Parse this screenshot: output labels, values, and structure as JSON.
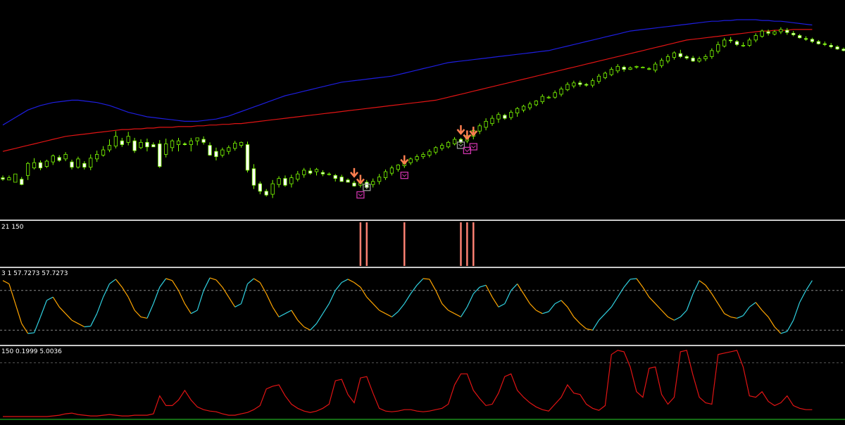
{
  "chart_data": [
    {
      "type": "candlestick",
      "pane": "price",
      "colors": {
        "background": "#000000",
        "bull": "#7CFC00",
        "bear": "#FFFFFF",
        "upper_band": "#1E1EE0",
        "lower_band": "#E01414",
        "arrow": "#FF7F50",
        "marker_magenta": "#CC33AA",
        "marker_gray": "#9A9A9A"
      },
      "candles": [
        [
          215,
          213,
          218,
          211
        ],
        [
          212,
          215,
          214,
          218
        ],
        [
          209,
          220,
          214,
          210
        ],
        [
          213,
          206,
          216,
          205
        ],
        [
          218,
          234,
          212,
          236
        ],
        [
          228,
          235,
          226,
          241
        ],
        [
          235,
          228,
          238,
          225
        ],
        [
          230,
          237,
          228,
          239
        ],
        [
          236,
          244,
          232,
          246
        ],
        [
          242,
          238,
          245,
          236
        ],
        [
          240,
          246,
          237,
          249
        ],
        [
          236,
          229,
          239,
          226
        ],
        [
          229,
          240,
          227,
          243
        ],
        [
          234,
          229,
          237,
          226
        ],
        [
          229,
          241,
          225,
          246
        ],
        [
          240,
          246,
          236,
          251
        ],
        [
          245,
          252,
          243,
          257
        ],
        [
          252,
          258,
          249,
          266
        ],
        [
          257,
          270,
          254,
          277
        ],
        [
          264,
          259,
          268,
          256
        ],
        [
          262,
          270,
          258,
          276
        ],
        [
          264,
          251,
          268,
          248
        ],
        [
          255,
          262,
          253,
          266
        ],
        [
          262,
          256,
          267,
          250
        ],
        [
          259,
          256,
          262,
          256
        ],
        [
          260,
          230,
          265,
          228
        ],
        [
          246,
          260,
          242,
          267
        ],
        [
          255,
          264,
          250,
          266
        ],
        [
          259,
          264,
          250,
          268
        ],
        [
          260,
          259,
          262,
          258
        ],
        [
          259,
          264,
          250,
          268
        ],
        [
          264,
          268,
          258,
          268
        ],
        [
          266,
          262,
          270,
          259
        ],
        [
          258,
          245,
          262,
          244
        ],
        [
          250,
          243,
          255,
          238
        ],
        [
          245,
          252,
          242,
          255
        ],
        [
          250,
          255,
          246,
          258
        ],
        [
          254,
          261,
          251,
          264
        ],
        [
          258,
          262,
          255,
          263
        ],
        [
          259,
          225,
          263,
          222
        ],
        [
          227,
          205,
          233,
          200
        ],
        [
          207,
          197,
          210,
          193
        ],
        [
          197,
          192,
          200,
          190
        ],
        [
          193,
          207,
          188,
          212
        ],
        [
          206,
          214,
          202,
          217
        ],
        [
          214,
          205,
          218,
          203
        ],
        [
          207,
          215,
          202,
          219
        ],
        [
          213,
          220,
          210,
          224
        ],
        [
          219,
          225,
          215,
          228
        ],
        [
          224,
          221,
          228,
          219
        ],
        [
          223,
          226,
          218,
          228
        ],
        [
          222,
          220,
          225,
          217
        ],
        [
          220,
          220,
          222,
          218
        ],
        [
          218,
          214,
          220,
          210
        ],
        [
          216,
          210,
          219,
          210
        ],
        [
          212,
          209,
          214,
          210
        ],
        [
          208,
          204,
          211,
          203
        ],
        [
          205,
          210,
          202,
          212
        ],
        [
          209,
          202,
          212,
          200
        ],
        [
          206,
          210,
          202,
          214
        ],
        [
          210,
          216,
          206,
          220
        ],
        [
          215,
          223,
          212,
          226
        ],
        [
          221,
          228,
          218,
          231
        ],
        [
          226,
          232,
          223,
          233
        ],
        [
          231,
          236,
          228,
          238
        ],
        [
          235,
          240,
          232,
          242
        ],
        [
          239,
          243,
          236,
          246
        ],
        [
          243,
          246,
          240,
          249
        ],
        [
          245,
          250,
          242,
          253
        ],
        [
          249,
          255,
          246,
          257
        ],
        [
          254,
          258,
          251,
          261
        ],
        [
          256,
          262,
          254,
          264
        ],
        [
          260,
          266,
          258,
          269
        ],
        [
          266,
          262,
          268,
          260
        ],
        [
          264,
          271,
          261,
          274
        ],
        [
          270,
          278,
          266,
          282
        ],
        [
          277,
          284,
          273,
          287
        ],
        [
          282,
          290,
          278,
          294
        ],
        [
          287,
          294,
          284,
          298
        ],
        [
          293,
          299,
          288,
          302
        ],
        [
          298,
          294,
          300,
          292
        ],
        [
          295,
          302,
          292,
          305
        ],
        [
          301,
          307,
          296,
          309
        ],
        [
          305,
          310,
          302,
          312
        ],
        [
          308,
          313,
          305,
          316
        ],
        [
          312,
          317,
          310,
          318
        ],
        [
          316,
          323,
          313,
          326
        ],
        [
          322,
          322,
          324,
          320
        ],
        [
          322,
          328,
          320,
          331
        ],
        [
          326,
          333,
          323,
          336
        ],
        [
          332,
          339,
          330,
          342
        ],
        [
          337,
          341,
          334,
          344
        ],
        [
          341,
          339,
          344,
          336
        ],
        [
          339,
          338,
          341,
          336
        ],
        [
          338,
          344,
          335,
          347
        ],
        [
          343,
          350,
          340,
          353
        ],
        [
          348,
          354,
          346,
          356
        ],
        [
          352,
          359,
          350,
          362
        ],
        [
          357,
          363,
          354,
          366
        ],
        [
          362,
          359,
          364,
          356
        ],
        [
          359,
          361,
          358,
          363
        ],
        [
          362,
          363,
          360,
          364
        ],
        [
          362,
          362,
          363,
          361
        ],
        [
          360,
          360,
          362,
          358
        ],
        [
          358,
          366,
          355,
          369
        ],
        [
          364,
          371,
          361,
          374
        ],
        [
          370,
          376,
          367,
          379
        ],
        [
          375,
          381,
          372,
          383
        ],
        [
          380,
          376,
          385,
          374
        ],
        [
          376,
          374,
          378,
          372
        ],
        [
          374,
          370,
          377,
          369
        ],
        [
          370,
          373,
          368,
          376
        ],
        [
          373,
          376,
          370,
          379
        ],
        [
          376,
          384,
          373,
          387
        ],
        [
          383,
          392,
          380,
          396
        ],
        [
          390,
          398,
          388,
          401
        ],
        [
          398,
          397,
          402,
          394
        ],
        [
          396,
          392,
          398,
          390
        ],
        [
          391,
          391,
          395,
          389
        ],
        [
          391,
          398,
          389,
          401
        ],
        [
          398,
          404,
          395,
          407
        ],
        [
          403,
          410,
          401,
          412
        ],
        [
          409,
          407,
          412,
          404
        ],
        [
          406,
          409,
          404,
          411
        ],
        [
          409,
          412,
          406,
          415
        ],
        [
          411,
          408,
          414,
          405
        ],
        [
          407,
          405,
          410,
          403
        ],
        [
          404,
          401,
          406,
          400
        ],
        [
          400,
          399,
          403,
          397
        ],
        [
          399,
          396,
          401,
          394
        ],
        [
          396,
          393,
          398,
          392
        ],
        [
          393,
          392,
          396,
          390
        ],
        [
          391,
          389,
          394,
          387
        ],
        [
          389,
          386,
          391,
          385
        ],
        [
          386,
          384,
          388,
          383
        ]
      ],
      "upper_band": [
        285,
        290,
        295,
        300,
        305,
        308,
        311,
        313,
        315,
        316,
        317,
        318,
        318,
        317,
        316,
        315,
        313,
        311,
        308,
        305,
        302,
        300,
        298,
        296,
        295,
        294,
        293,
        292,
        291,
        290,
        290,
        290,
        291,
        292,
        293,
        295,
        297,
        300,
        303,
        306,
        309,
        312,
        315,
        318,
        321,
        324,
        326,
        328,
        330,
        332,
        334,
        336,
        338,
        340,
        342,
        343,
        344,
        345,
        346,
        347,
        348,
        349,
        350,
        352,
        354,
        356,
        358,
        360,
        362,
        364,
        366,
        368,
        369,
        370,
        371,
        372,
        373,
        374,
        375,
        376,
        377,
        378,
        379,
        380,
        381,
        382,
        383,
        384,
        386,
        388,
        390,
        392,
        394,
        396,
        398,
        400,
        402,
        404,
        406,
        408,
        410,
        411,
        412,
        413,
        414,
        415,
        416,
        417,
        418,
        419,
        420,
        421,
        422,
        423,
        423,
        424,
        424,
        425,
        425,
        425,
        425,
        424,
        424,
        423,
        423,
        422,
        421,
        420,
        419,
        418
      ],
      "lower_band": [
        250,
        252,
        254,
        256,
        258,
        260,
        262,
        264,
        266,
        268,
        270,
        271,
        272,
        273,
        274,
        275,
        276,
        277,
        278,
        279,
        279,
        280,
        280,
        281,
        281,
        282,
        282,
        282,
        283,
        283,
        283,
        284,
        284,
        285,
        285,
        286,
        286,
        287,
        287,
        288,
        289,
        290,
        291,
        292,
        293,
        294,
        295,
        296,
        297,
        298,
        299,
        300,
        301,
        302,
        303,
        304,
        305,
        306,
        307,
        308,
        309,
        310,
        311,
        312,
        313,
        314,
        315,
        316,
        317,
        318,
        320,
        322,
        324,
        326,
        328,
        330,
        332,
        334,
        336,
        338,
        340,
        342,
        344,
        346,
        348,
        350,
        352,
        354,
        356,
        358,
        360,
        362,
        364,
        366,
        368,
        370,
        372,
        374,
        376,
        378,
        380,
        382,
        384,
        386,
        388,
        390,
        392,
        394,
        396,
        398,
        399,
        400,
        401,
        402,
        403,
        404,
        405,
        406,
        407,
        408,
        409,
        410,
        410,
        411,
        411,
        411,
        412,
        412,
        412,
        412
      ],
      "arrows": [
        56,
        57,
        64,
        73,
        74,
        75
      ],
      "markers": [
        {
          "bar": 57,
          "style": "magenta"
        },
        {
          "bar": 58,
          "style": "gray"
        },
        {
          "bar": 64,
          "style": "magenta"
        },
        {
          "bar": 73,
          "style": "gray"
        },
        {
          "bar": 74,
          "style": "magenta"
        },
        {
          "bar": 75,
          "style": "magenta"
        }
      ]
    },
    {
      "type": "signal",
      "pane": "signals",
      "label": "21 150",
      "color": "#FA8072",
      "signal_bars": [
        57,
        58,
        64,
        73,
        74,
        75
      ]
    },
    {
      "type": "line",
      "pane": "oscillator",
      "label": "3 1 57.7273 57.7273",
      "colors": {
        "up": "#30D0E0",
        "down": "#FFA500",
        "level": "#888888"
      },
      "levels": [
        80,
        20
      ],
      "ylim": [
        0,
        100
      ],
      "values": [
        95,
        90,
        60,
        30,
        15,
        16,
        40,
        65,
        70,
        55,
        45,
        35,
        30,
        25,
        26,
        45,
        70,
        90,
        97,
        85,
        70,
        50,
        40,
        38,
        60,
        85,
        98,
        95,
        80,
        60,
        45,
        50,
        80,
        99,
        96,
        85,
        70,
        55,
        60,
        90,
        98,
        92,
        75,
        55,
        40,
        45,
        50,
        35,
        25,
        20,
        30,
        45,
        60,
        80,
        92,
        97,
        92,
        85,
        70,
        60,
        50,
        45,
        40,
        48,
        60,
        75,
        88,
        98,
        97,
        80,
        60,
        50,
        45,
        40,
        55,
        75,
        85,
        88,
        70,
        55,
        60,
        80,
        90,
        75,
        60,
        50,
        45,
        48,
        60,
        65,
        55,
        40,
        30,
        22,
        20,
        35,
        45,
        55,
        70,
        85,
        97,
        98,
        85,
        70,
        60,
        50,
        40,
        35,
        40,
        50,
        75,
        95,
        88,
        75,
        60,
        45,
        40,
        38,
        42,
        55,
        62,
        50,
        40,
        25,
        15,
        18,
        35,
        62,
        80,
        95
      ]
    },
    {
      "type": "line",
      "pane": "volatility",
      "label": "150 0.1999 5.0036",
      "colors": {
        "line": "#E01414",
        "base": "#1A8C1A",
        "level": "#555555"
      },
      "levels": [
        4.0
      ],
      "ylim": [
        0,
        5.1
      ],
      "values": [
        0.1,
        0.1,
        0.1,
        0.1,
        0.1,
        0.1,
        0.1,
        0.1,
        0.15,
        0.2,
        0.3,
        0.35,
        0.25,
        0.2,
        0.15,
        0.15,
        0.2,
        0.25,
        0.2,
        0.15,
        0.15,
        0.2,
        0.2,
        0.2,
        0.3,
        1.6,
        0.9,
        0.9,
        1.3,
        2.0,
        1.3,
        0.8,
        0.6,
        0.5,
        0.45,
        0.3,
        0.2,
        0.2,
        0.3,
        0.4,
        0.6,
        0.9,
        2.1,
        2.3,
        2.4,
        1.6,
        1.0,
        0.7,
        0.5,
        0.4,
        0.5,
        0.7,
        1.0,
        2.7,
        2.8,
        1.7,
        1.1,
        2.9,
        3.0,
        1.8,
        0.7,
        0.5,
        0.45,
        0.5,
        0.6,
        0.6,
        0.5,
        0.45,
        0.5,
        0.6,
        0.7,
        1.0,
        2.4,
        3.2,
        3.2,
        2.0,
        1.4,
        0.9,
        1.0,
        1.8,
        3.0,
        3.2,
        2.0,
        1.5,
        1.1,
        0.8,
        0.6,
        0.5,
        1.0,
        1.5,
        2.4,
        1.8,
        1.7,
        1.0,
        0.7,
        0.55,
        0.9,
        4.6,
        4.9,
        4.8,
        3.7,
        1.9,
        1.5,
        3.6,
        3.7,
        1.7,
        1.0,
        1.5,
        4.8,
        4.9,
        3.1,
        1.5,
        1.1,
        1.0,
        4.6,
        4.7,
        4.8,
        4.9,
        3.7,
        1.6,
        1.5,
        1.9,
        1.2,
        0.9,
        1.1,
        1.6,
        0.9,
        0.7,
        0.6,
        0.6
      ]
    }
  ]
}
